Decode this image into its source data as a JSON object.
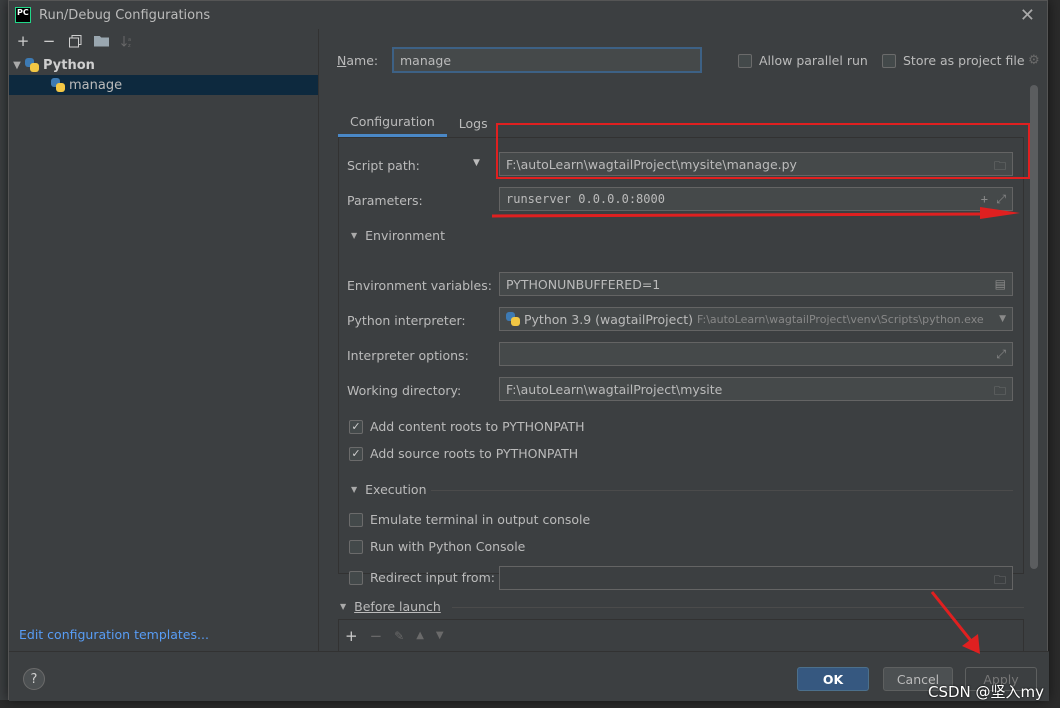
{
  "window": {
    "title": "Run/Debug Configurations",
    "app_logo": "PC"
  },
  "left_toolbar": {
    "add": "+",
    "remove": "−",
    "copy": "⧉",
    "folder": "🗀",
    "sort": "↓a"
  },
  "tree": {
    "group": "Python",
    "item": "manage"
  },
  "edit_templates_link": "Edit configuration templates...",
  "name_field": {
    "label": "Name:",
    "value": "manage"
  },
  "allow_parallel": {
    "label": "Allow parallel run",
    "checked": false
  },
  "store_as_project": {
    "label": "Store as project file",
    "checked": false
  },
  "tabs": [
    "Configuration",
    "Logs"
  ],
  "config": {
    "script_path": {
      "label": "Script path:",
      "value": "F:\\autoLearn\\wagtailProject\\mysite\\manage.py"
    },
    "parameters": {
      "label": "Parameters:",
      "value": "runserver 0.0.0.0:8000"
    },
    "environment_section": "Environment",
    "env_vars": {
      "label": "Environment variables:",
      "value": "PYTHONUNBUFFERED=1"
    },
    "interpreter": {
      "label": "Python interpreter:",
      "value": "Python 3.9 (wagtailProject)",
      "path": "F:\\autoLearn\\wagtailProject\\venv\\Scripts\\python.exe"
    },
    "interpreter_options": {
      "label": "Interpreter options:",
      "value": ""
    },
    "working_dir": {
      "label": "Working directory:",
      "value": "F:\\autoLearn\\wagtailProject\\mysite"
    },
    "content_roots": {
      "label": "Add content roots to PYTHONPATH",
      "checked": true
    },
    "source_roots": {
      "label": "Add source roots to PYTHONPATH",
      "checked": true
    },
    "execution_section": "Execution",
    "emulate_terminal": {
      "label": "Emulate terminal in output console",
      "checked": false
    },
    "python_console": {
      "label": "Run with Python Console",
      "checked": false
    },
    "redirect_input": {
      "label": "Redirect input from:",
      "checked": false,
      "value": ""
    }
  },
  "before_launch": "Before launch",
  "buttons": {
    "ok": "OK",
    "cancel": "Cancel",
    "apply": "Apply",
    "help": "?"
  },
  "watermark": "CSDN @坚入my",
  "colors": {
    "accent": "#4a88c7",
    "annotation": "#e02020",
    "ok_button": "#365880",
    "link": "#589df6"
  }
}
